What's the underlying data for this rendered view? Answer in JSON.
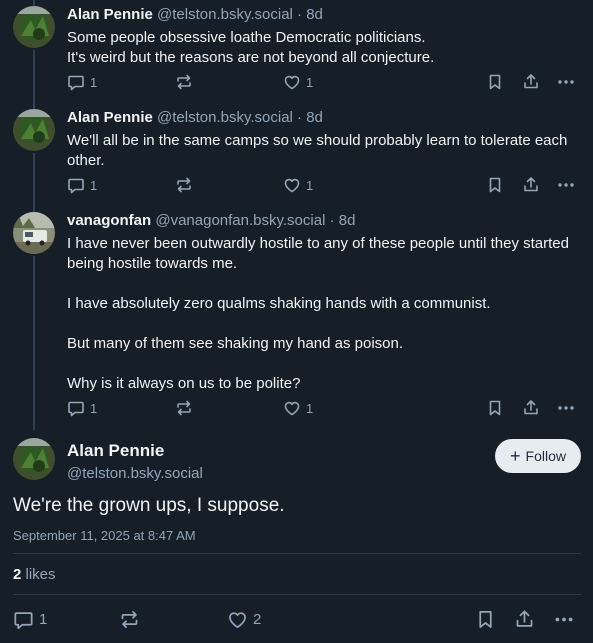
{
  "posts": [
    {
      "name": "Alan Pennie",
      "handle": "@telston.bsky.social",
      "sep": " · ",
      "age": "8d",
      "lines": [
        "Some people obsessive loathe Democratic politicians.",
        "It's weird but the reasons are not beyond all conjecture."
      ],
      "replies": "1",
      "likes": "1"
    },
    {
      "name": "Alan Pennie",
      "handle": "@telston.bsky.social",
      "sep": " · ",
      "age": "8d",
      "lines": [
        "We'll all be in the same camps so we should probably learn to tolerate each other."
      ],
      "replies": "1",
      "likes": "1"
    },
    {
      "name": "vanagonfan",
      "handle": "@vanagonfan.bsky.social",
      "sep": " · ",
      "age": "8d",
      "lines": [
        "I have never been outwardly hostile to any of these people until they started being hostile towards me.",
        "I have absolutely zero qualms shaking hands with a communist.",
        "But many of them see shaking my hand as poison.",
        "Why is it always on us to be polite?"
      ],
      "replies": "1",
      "likes": "1"
    }
  ],
  "focus": {
    "name": "Alan Pennie",
    "handle": "@telston.bsky.social",
    "follow_label": "Follow",
    "follow_plus": "+",
    "text": "We're the grown ups, I suppose.",
    "timestamp": "September 11, 2025 at 8:47 AM",
    "like_count": "2",
    "like_word": " likes",
    "replies": "1",
    "likes": "2"
  },
  "colors": {
    "background": "#161e27",
    "muted": "#93a5b7",
    "text": "#f1f3f5",
    "thread_line": "#2e4052"
  },
  "icons": [
    "reply-icon",
    "repost-icon",
    "like-icon",
    "bookmark-icon",
    "share-icon",
    "more-icon",
    "plus-icon"
  ]
}
